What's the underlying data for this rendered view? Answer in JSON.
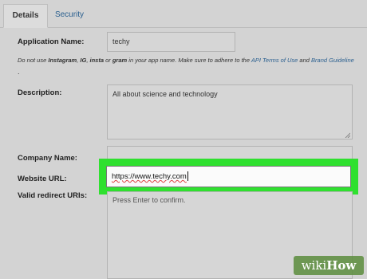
{
  "tabs": [
    {
      "label": "Details",
      "active": true
    },
    {
      "label": "Security",
      "active": false
    }
  ],
  "form": {
    "app_name": {
      "label": "Application Name:",
      "value": "techy"
    },
    "note": {
      "p1": "Do not use ",
      "k1": "Instagram",
      "p2": ", ",
      "k2": "IG",
      "p3": ", ",
      "k3": "insta",
      "p4": " or ",
      "k4": "gram",
      "p5": " in your app name. Make sure to adhere to the ",
      "link1": "API Terms of Use",
      "p6": " and ",
      "link2": "Brand Guideline",
      "trail": "."
    },
    "description": {
      "label": "Description:",
      "value": "All about science and technology"
    },
    "company": {
      "label": "Company Name:",
      "value": ""
    },
    "website": {
      "label": "Website URL:",
      "value": "https://www.techy.com"
    },
    "redirect": {
      "label": "Valid redirect URIs:",
      "placeholder": "Press Enter to confirm."
    }
  },
  "watermark": {
    "wiki": "wiki",
    "how": "How"
  },
  "colors": {
    "highlight": "#2fe02f",
    "link": "#2a5f8f",
    "background": "#d3d3d3"
  }
}
